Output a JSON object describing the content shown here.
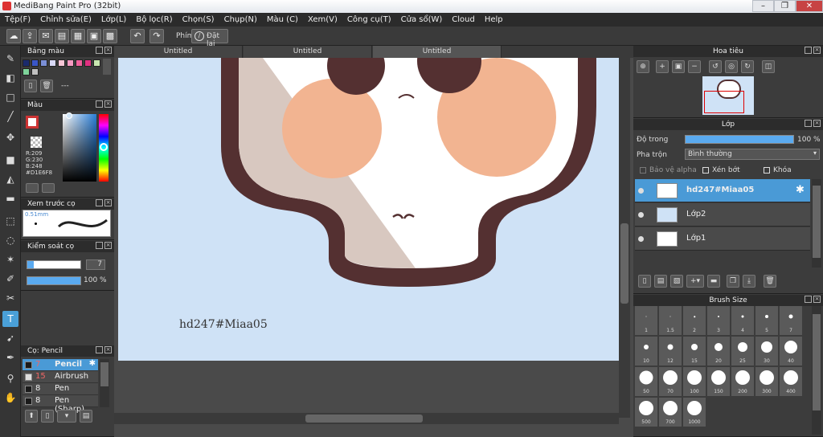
{
  "window": {
    "title": "MediBang Paint Pro (32bit)",
    "controls": [
      "–",
      "❐",
      "✕"
    ]
  },
  "menu": [
    "Tệp(F)",
    "Chỉnh sửa(E)",
    "Lớp(L)",
    "Bộ lọc(R)",
    "Chọn(S)",
    "Chụp(N)",
    "Màu (C)",
    "Xem(V)",
    "Công cụ(T)",
    "Cửa sổ(W)",
    "Cloud",
    "Help"
  ],
  "toolbar": {
    "shortcut_label": "Phím",
    "reset_label": "Đặt lại"
  },
  "tabs": [
    "Untitled",
    "Untitled",
    "Untitled"
  ],
  "palette": {
    "title": "Bảng màu",
    "footer": "---",
    "colors": [
      "#1a2a6c",
      "#3a56c8",
      "#7b8fd6",
      "#d9d9f7",
      "#f7c7d7",
      "#f59ac2",
      "#f0609c",
      "#e03080",
      "#c8e6b0",
      "#7ed39a",
      "#c0c0c0"
    ]
  },
  "color": {
    "title": "Màu",
    "r": "R:209",
    "g": "G:230",
    "b": "B:248",
    "hex": "#D1E6F8",
    "current": "#D1E6F8"
  },
  "brush_preview": {
    "title": "Xem trước cọ",
    "size": "0.51mm"
  },
  "brush_control": {
    "title": "Kiểm soát cọ",
    "size_value": "7",
    "opacity_value": "100 %"
  },
  "brush_list": {
    "title": "Cọ: Pencil",
    "items": [
      {
        "size": "7",
        "name": "Pencil"
      },
      {
        "size": "15",
        "name": "Airbrush"
      },
      {
        "size": "8",
        "name": "Pen"
      },
      {
        "size": "8",
        "name": "Pen (Sharp)"
      }
    ]
  },
  "navigator": {
    "title": "Hoa tiêu"
  },
  "layer": {
    "title": "Lớp",
    "opacity_label": "Độ trong",
    "opacity_value": "100 %",
    "blend_label": "Pha trộn",
    "blend_value": "Bình thường",
    "protect_alpha": "Bảo vệ alpha",
    "clip": "Xén bớt",
    "lock": "Khóa",
    "layers": [
      {
        "name": "hd247#Miaa05",
        "active": true
      },
      {
        "name": "Lớp2",
        "active": false
      },
      {
        "name": "Lớp1",
        "active": false
      }
    ]
  },
  "brush_size": {
    "title": "Brush Size",
    "sizes": [
      "1",
      "1.5",
      "2",
      "3",
      "4",
      "5",
      "7",
      "10",
      "12",
      "15",
      "20",
      "25",
      "30",
      "40",
      "50",
      "70",
      "100",
      "150",
      "200",
      "300",
      "400",
      "500",
      "700",
      "1000"
    ]
  },
  "canvas": {
    "text": "hd247#Miaa05",
    "bg": "#CFE2F6"
  }
}
